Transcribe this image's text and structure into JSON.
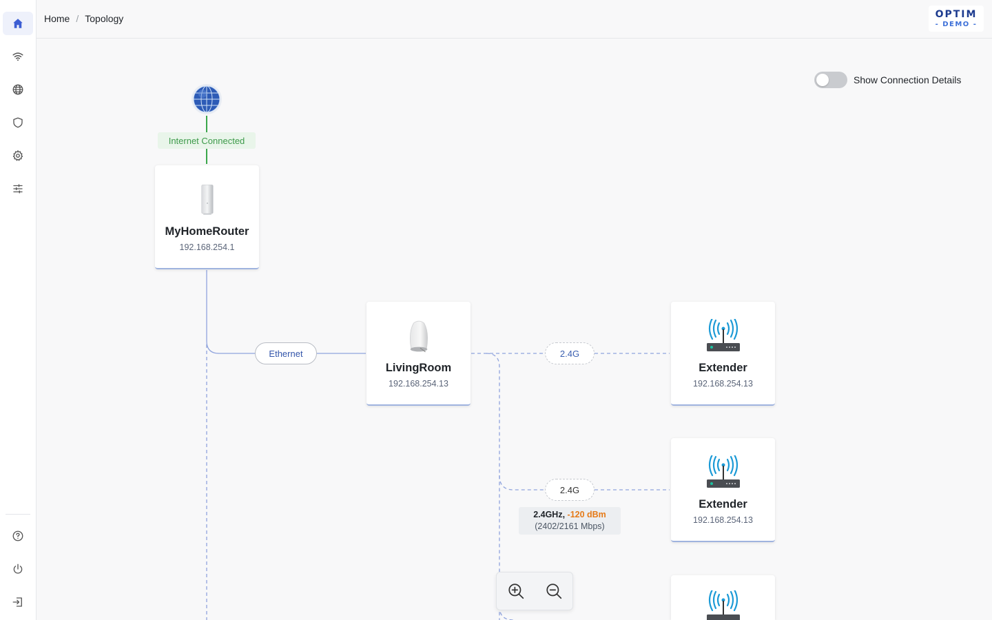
{
  "breadcrumb": {
    "home": "Home",
    "separator": "/",
    "current": "Topology"
  },
  "brand": {
    "name": "OPTIM",
    "sub": "- DEMO -"
  },
  "sidebar": {
    "top_items": [
      {
        "icon": "home-icon",
        "active": true
      },
      {
        "icon": "wifi-icon",
        "active": false
      },
      {
        "icon": "globe-icon",
        "active": false
      },
      {
        "icon": "shield-icon",
        "active": false
      },
      {
        "icon": "gear-icon",
        "active": false
      },
      {
        "icon": "sliders-icon",
        "active": false
      }
    ],
    "bottom_items": [
      {
        "icon": "help-icon"
      },
      {
        "icon": "power-icon"
      },
      {
        "icon": "logout-icon"
      }
    ]
  },
  "toggle": {
    "label": "Show Connection Details",
    "on": false
  },
  "internet": {
    "status": "Internet Connected",
    "color": "#3d9a4a"
  },
  "nodes": {
    "router": {
      "name": "MyHomeRouter",
      "ip": "192.168.254.1"
    },
    "living_room": {
      "name": "LivingRoom",
      "ip": "192.168.254.13"
    },
    "extender_1": {
      "name": "Extender",
      "ip": "192.168.254.13"
    },
    "extender_2": {
      "name": "Extender",
      "ip": "192.168.254.13"
    },
    "extender_3": {
      "name": "",
      "ip": ""
    }
  },
  "links": {
    "ethernet": "Ethernet",
    "wifi_1": "2.4G",
    "wifi_2": "2.4G"
  },
  "connection_details": {
    "band": "2.4GHz,",
    "rssi": "-120 dBm",
    "rate": "(2402/2161 Mbps)"
  },
  "colors": {
    "accent": "#3c5ed3",
    "link": "#8fa3dd",
    "signal": "#1b9ad6",
    "warning": "#e57a18"
  }
}
